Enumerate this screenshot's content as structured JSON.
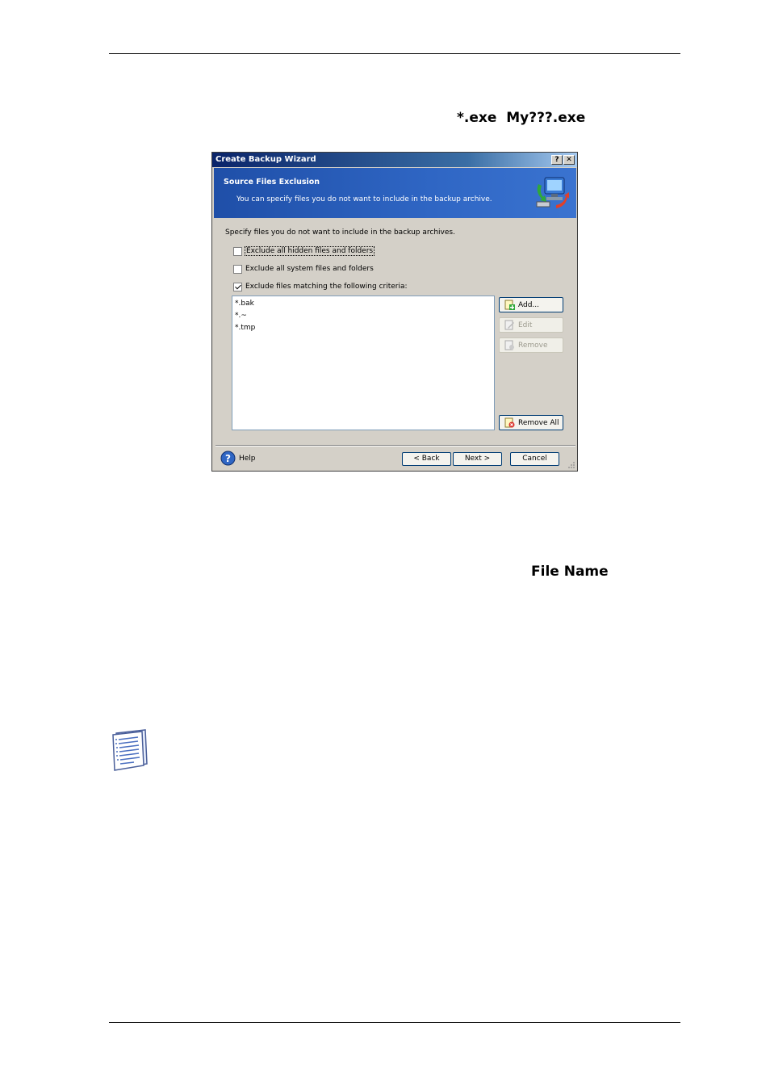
{
  "page": {
    "text_exe": "*.exe  My???.exe",
    "text_filename": "File Name"
  },
  "dialog": {
    "title": "Create Backup Wizard",
    "help_btn": "?",
    "close_btn": "✕",
    "banner_title": "Source Files Exclusion",
    "banner_subtitle": "You can specify files you do not want to include in the backup archive.",
    "intro": "Specify files you do not want to include in the backup archives.",
    "checks": [
      {
        "label": "Exclude all hidden files and folders",
        "checked": false
      },
      {
        "label": "Exclude all system files and folders",
        "checked": false
      },
      {
        "label": "Exclude files matching the following criteria:",
        "checked": true
      }
    ],
    "criteria": [
      "*.bak",
      "*.~",
      "*.tmp"
    ],
    "buttons": {
      "add": "Add...",
      "edit": "Edit",
      "remove": "Remove",
      "remove_all": "Remove All"
    },
    "help": "Help",
    "back": "< Back",
    "next": "Next >",
    "cancel": "Cancel"
  },
  "colors": {
    "banner": "#2f66c4",
    "titlebar": "#0a246a",
    "dialog_bg": "#d4d0c8"
  }
}
